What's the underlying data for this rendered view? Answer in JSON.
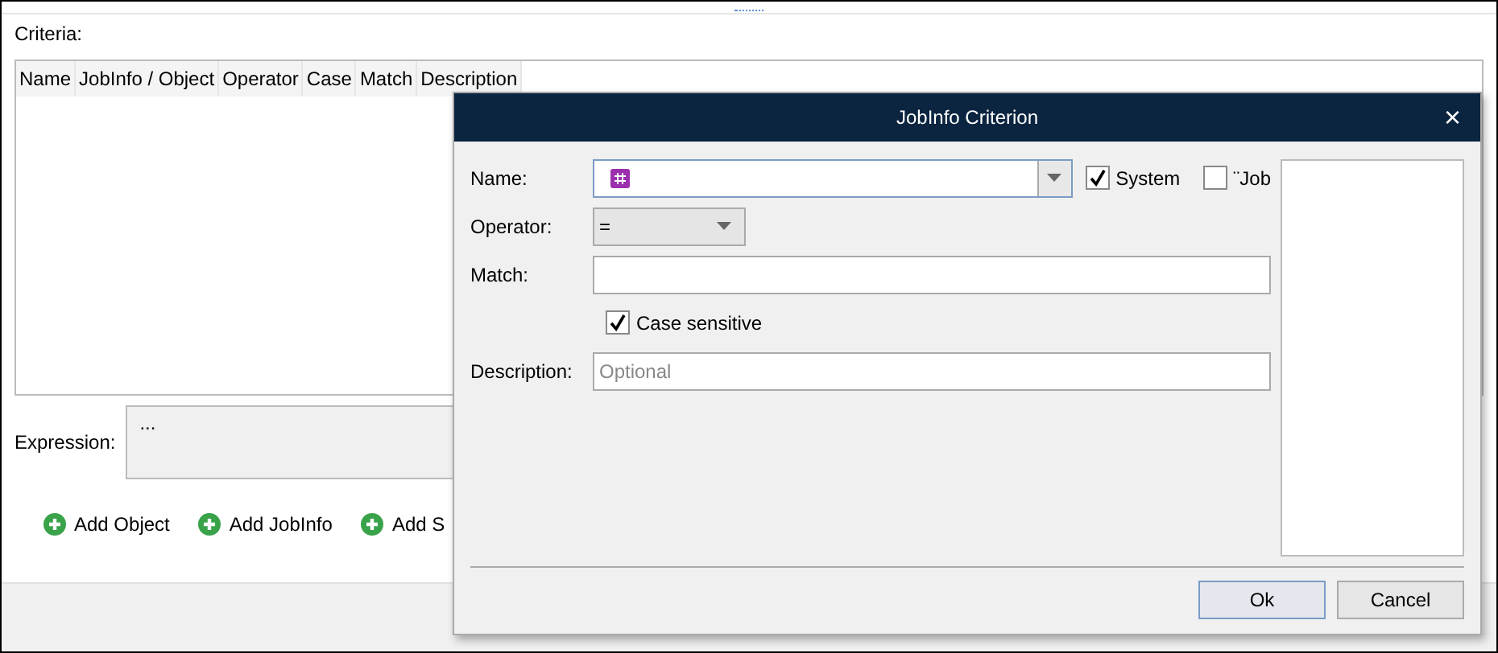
{
  "criteria": {
    "label": "Criteria:",
    "columns": [
      "Name",
      "JobInfo / Object",
      "Operator",
      "Case",
      "Match",
      "Description"
    ]
  },
  "expression": {
    "label": "Expression:",
    "value": "..."
  },
  "actions": [
    "Add Object",
    "Add JobInfo",
    "Add S"
  ],
  "dialog": {
    "title": "JobInfo Criterion",
    "close": "×",
    "name": {
      "label": "Name:"
    },
    "system": {
      "label": "System",
      "checked": true
    },
    "job": {
      "label": "¨Job",
      "checked": false
    },
    "operator": {
      "label": "Operator:",
      "value": "="
    },
    "match": {
      "label": "Match:"
    },
    "case_sensitive": {
      "label": "Case sensitive",
      "checked": true
    },
    "description": {
      "label": "Description:",
      "placeholder": "Optional"
    },
    "buttons": [
      {
        "label": "Ok",
        "kind": "default"
      },
      {
        "label": "Cancel",
        "kind": "normal"
      }
    ]
  }
}
